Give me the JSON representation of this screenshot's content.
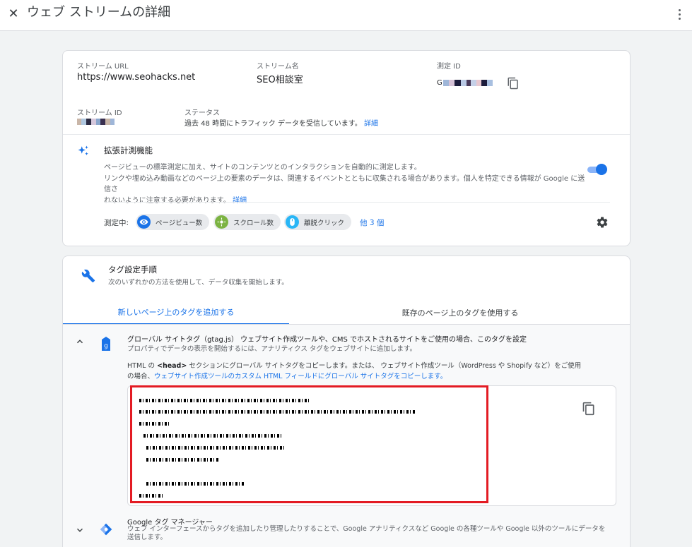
{
  "header": {
    "title": "ウェブ ストリームの詳細"
  },
  "stream": {
    "url_label": "ストリーム URL",
    "url_value": "https://www.seohacks.net",
    "name_label": "ストリーム名",
    "name_value": "SEO相談室",
    "measurement_id_label": "測定 ID",
    "measurement_id_prefix": "G",
    "stream_id_label": "ストリーム ID",
    "status_label": "ステータス",
    "status_text": "過去 48 時間にトラフィック データを受信しています。",
    "status_link": "詳細"
  },
  "enhanced": {
    "title": "拡張計測機能",
    "desc_line1": "ページビューの標準測定に加え、サイトのコンテンツとのインタラクションを自動的に測定します。",
    "desc_line2": "リンクや埋め込み動画などのページ上の要素のデータは、関連するイベントとともに収集される場合があります。個人を特定できる情報が Google に送信さ",
    "desc_line3": "れないように注意する必要があります。",
    "desc_link": "詳細",
    "enabled": true,
    "measuring_label": "測定中:",
    "chips": [
      {
        "label": "ページビュー数",
        "icon": "eye-icon",
        "color": "#1a73e8"
      },
      {
        "label": "スクロール数",
        "icon": "crosshair-icon",
        "color": "#7cb342"
      },
      {
        "label": "離脱クリック",
        "icon": "mouse-icon",
        "color": "#29b6f6"
      }
    ],
    "more_link": "他 3 個"
  },
  "tagging": {
    "title": "タグ設定手順",
    "subtitle": "次のいずれかの方法を使用して、データ収集を開始します。",
    "tabs": [
      {
        "label": "新しいページ上のタグを追加する",
        "active": true
      },
      {
        "label": "既存のページ上のタグを使用する",
        "active": false
      }
    ],
    "global_tag": {
      "title": "グローバル サイトタグ（gtag.js） ウェブサイト作成ツールや、CMS でホストされるサイトをご使用の場合、このタグを設定",
      "subtitle": "プロパティでデータの表示を開始するには、アナリティクス タグをウェブサイトに追加します。",
      "note_part1": "HTML の ",
      "note_bold": "<head>",
      "note_part2": " セクションにグローバル サイトタグをコピーします。または、 ウェブサイト作成ツール（WordPress や Shopify など）をご使用",
      "note_part3": "の場合、",
      "note_link": "ウェブサイト作成ツールのカスタム HTML フィールドにグローバル サイトタグをコピーします。"
    },
    "gtm": {
      "title": "Google タグ マネージャー",
      "desc_line1": "ウェブ インターフェースからタグを追加したり管理したりすることで、Google アナリティクスなど Google の各種ツールや Google 以外のツールにデータを",
      "desc_line2": "送信します。"
    }
  },
  "colors": {
    "accent": "#1a73e8",
    "highlight": "#e31b23"
  }
}
